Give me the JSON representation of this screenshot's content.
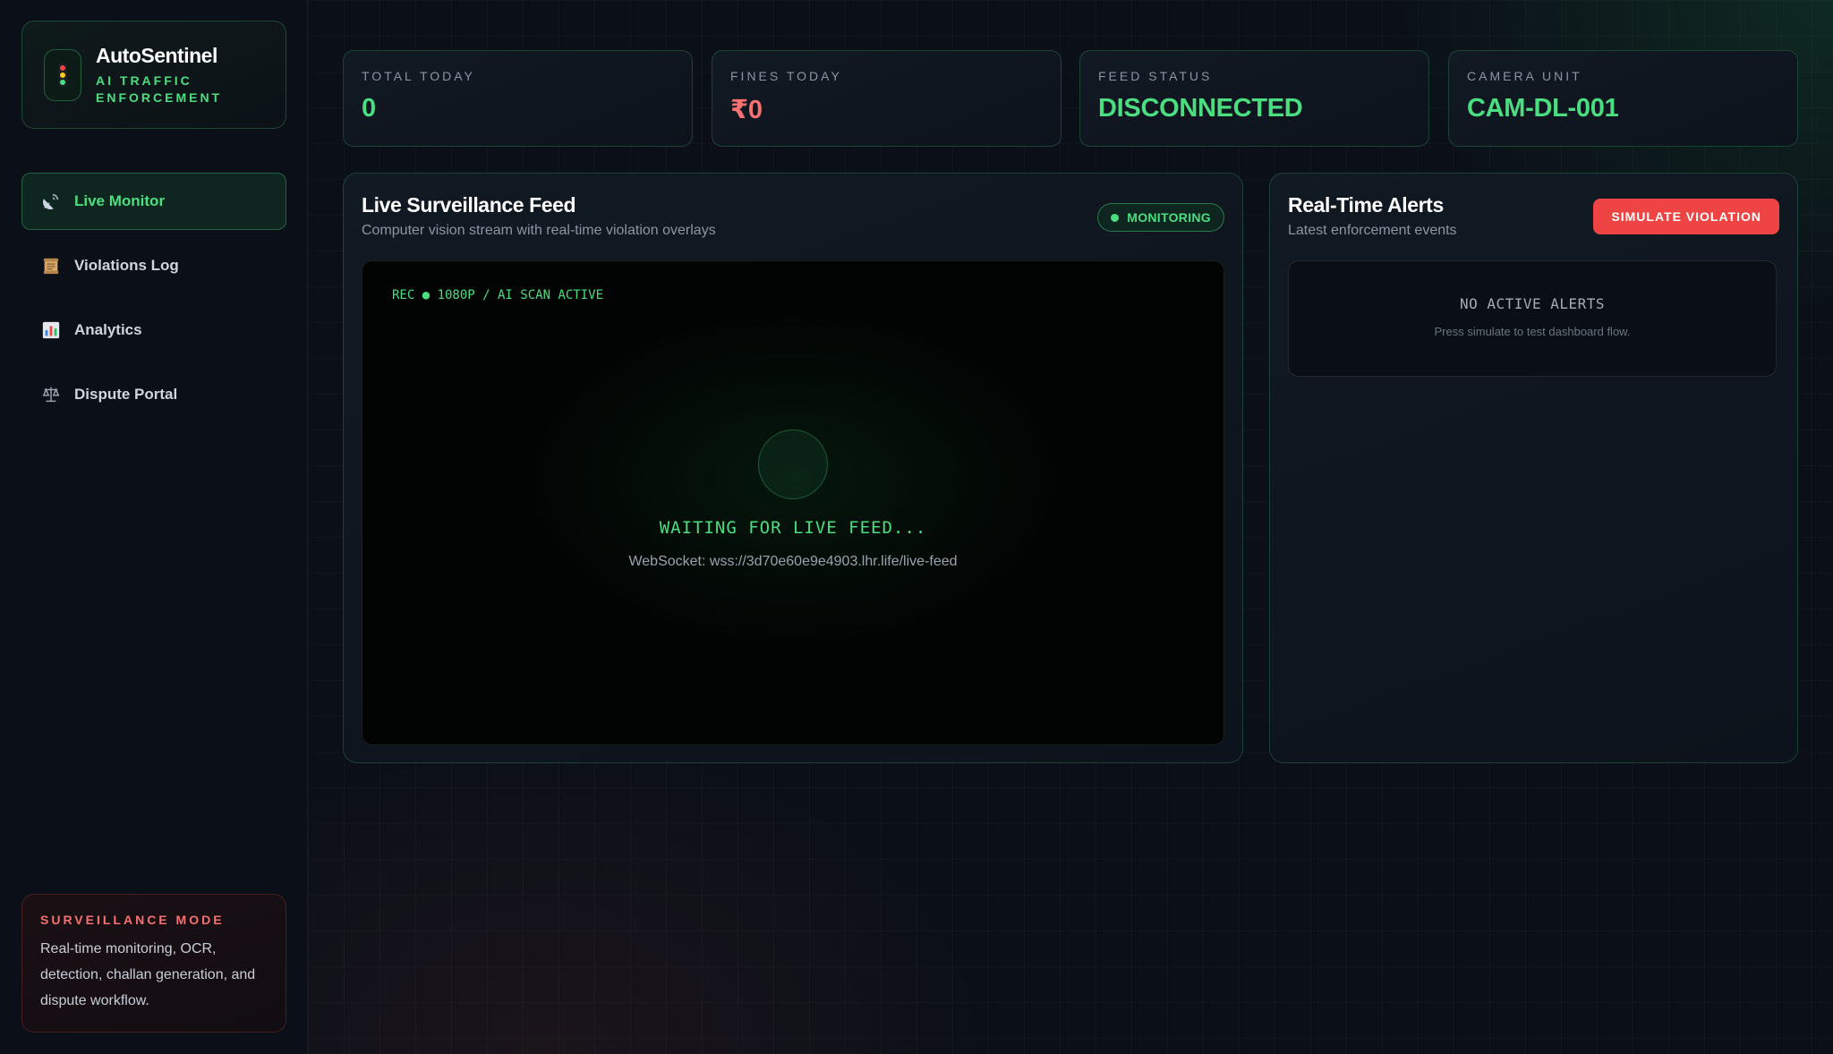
{
  "brand": {
    "title": "AutoSentinel",
    "subtitle": "AI TRAFFIC ENFORCEMENT",
    "icon": "traffic-light-icon"
  },
  "nav": {
    "items": [
      {
        "label": "Live Monitor",
        "icon": "satellite-dish-icon",
        "active": true
      },
      {
        "label": "Violations Log",
        "icon": "scroll-icon",
        "active": false
      },
      {
        "label": "Analytics",
        "icon": "bar-chart-icon",
        "active": false
      },
      {
        "label": "Dispute Portal",
        "icon": "scales-icon",
        "active": false
      }
    ]
  },
  "mode_card": {
    "title": "SURVEILLANCE MODE",
    "text": "Real-time monitoring, OCR, detection, challan generation, and dispute workflow."
  },
  "stats": [
    {
      "label": "TOTAL TODAY",
      "value": "0",
      "color": "#4ade80"
    },
    {
      "label": "FINES TODAY",
      "value": "₹0",
      "color": "#f87171"
    },
    {
      "label": "FEED STATUS",
      "value": "DISCONNECTED",
      "color": "#4ade80"
    },
    {
      "label": "CAMERA UNIT",
      "value": "CAM-DL-001",
      "color": "#4ade80"
    }
  ],
  "feed_panel": {
    "title": "Live Surveillance Feed",
    "subtitle": "Computer vision stream with real-time violation overlays",
    "badge": "MONITORING",
    "rec_text": "REC ● 1080P / AI SCAN ACTIVE",
    "waiting_text": "WAITING FOR LIVE FEED...",
    "websocket_text": "WebSocket: wss://3d70e60e9e4903.lhr.life/live-feed"
  },
  "alerts_panel": {
    "title": "Real-Time Alerts",
    "subtitle": "Latest enforcement events",
    "button": "SIMULATE VIOLATION",
    "empty_title": "NO ACTIVE ALERTS",
    "empty_sub": "Press simulate to test dashboard flow."
  },
  "colors": {
    "accent_green": "#4ade80",
    "accent_red": "#ef4444"
  }
}
